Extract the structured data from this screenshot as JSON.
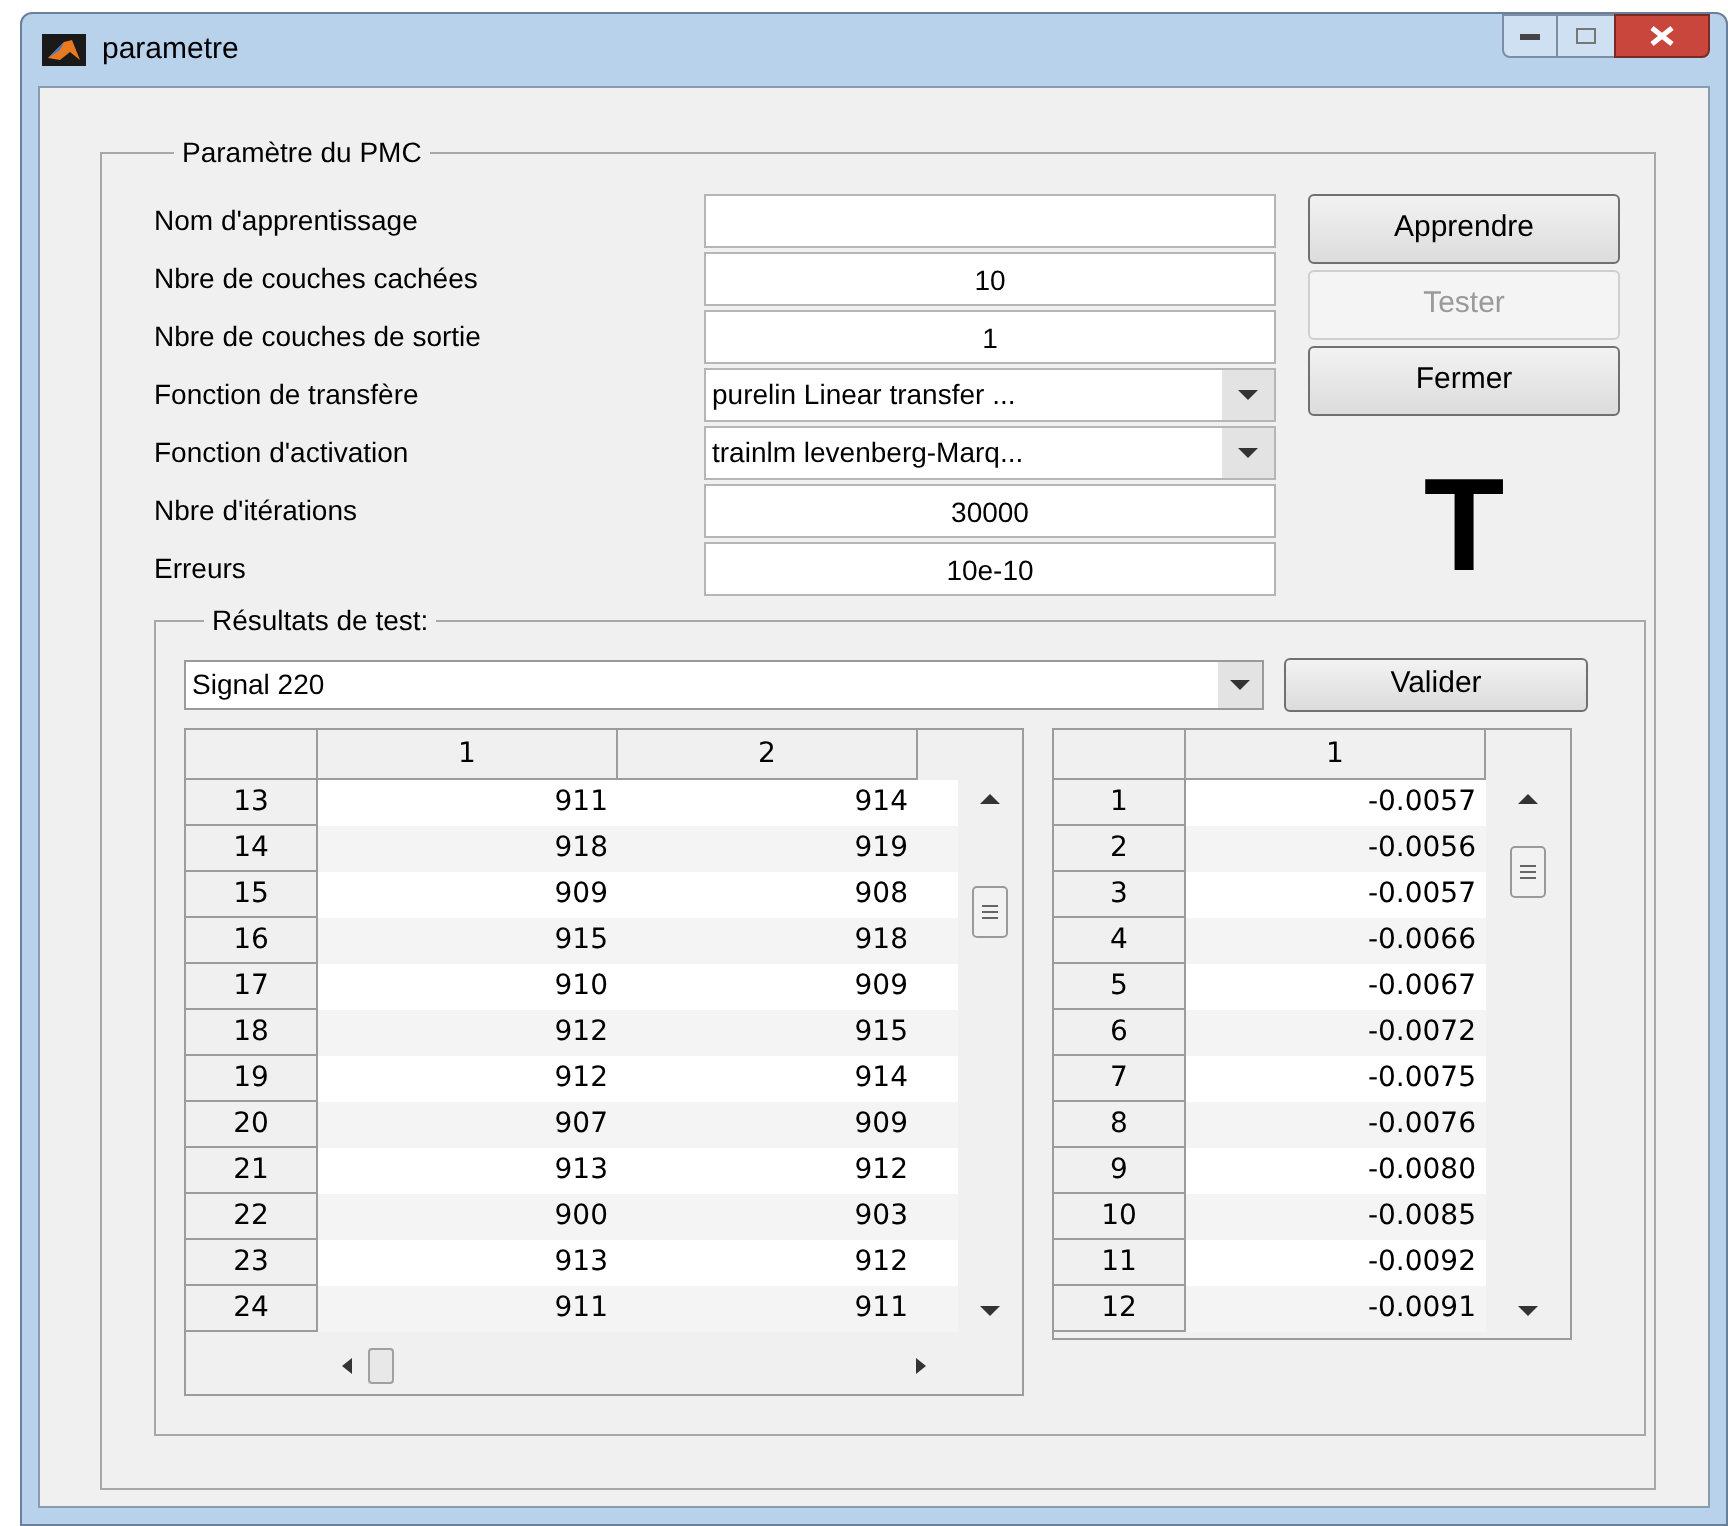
{
  "window": {
    "title": "parametre"
  },
  "parameters": {
    "title": "Paramètre du PMC",
    "fields": [
      {
        "label": "Nom d'apprentissage",
        "kind": "text"
      },
      {
        "label": "Nbre de couches cachées",
        "kind": "text",
        "value": "10"
      },
      {
        "label": "Nbre de couches de sortie",
        "kind": "text",
        "value": "1"
      },
      {
        "label": "Fonction de transfère",
        "kind": "dropdown",
        "value": "purelin Linear transfer ..."
      },
      {
        "label": "Fonction d'activation",
        "kind": "dropdown",
        "value": "trainlm levenberg-Marq..."
      },
      {
        "label": "Nbre d'itérations",
        "kind": "text",
        "value": "30000"
      },
      {
        "label": "Erreurs",
        "kind": "text",
        "value": "10e-10"
      }
    ],
    "buttons": [
      {
        "label": "Apprendre",
        "disabled": false
      },
      {
        "label": "Tester",
        "disabled": true
      },
      {
        "label": "Fermer",
        "disabled": false
      }
    ],
    "big_letter": "T"
  },
  "results": {
    "title": "Résultats de test:",
    "signal": "Signal 220",
    "validate": "Valider",
    "input_table": {
      "columns": [
        "1",
        "2"
      ],
      "rows": [
        {
          "header": "13",
          "cells": [
            "911",
            "914"
          ]
        },
        {
          "header": "14",
          "cells": [
            "918",
            "919"
          ]
        },
        {
          "header": "15",
          "cells": [
            "909",
            "908"
          ]
        },
        {
          "header": "16",
          "cells": [
            "915",
            "918"
          ]
        },
        {
          "header": "17",
          "cells": [
            "910",
            "909"
          ]
        },
        {
          "header": "18",
          "cells": [
            "912",
            "915"
          ]
        },
        {
          "header": "19",
          "cells": [
            "912",
            "914"
          ]
        },
        {
          "header": "20",
          "cells": [
            "907",
            "909"
          ]
        },
        {
          "header": "21",
          "cells": [
            "913",
            "912"
          ]
        },
        {
          "header": "22",
          "cells": [
            "900",
            "903"
          ]
        },
        {
          "header": "23",
          "cells": [
            "913",
            "912"
          ]
        },
        {
          "header": "24",
          "cells": [
            "911",
            "911"
          ]
        }
      ]
    },
    "output_table": {
      "columns": [
        "1"
      ],
      "rows": [
        {
          "header": "1",
          "cells": [
            "-0.0057"
          ]
        },
        {
          "header": "2",
          "cells": [
            "-0.0056"
          ]
        },
        {
          "header": "3",
          "cells": [
            "-0.0057"
          ]
        },
        {
          "header": "4",
          "cells": [
            "-0.0066"
          ]
        },
        {
          "header": "5",
          "cells": [
            "-0.0067"
          ]
        },
        {
          "header": "6",
          "cells": [
            "-0.0072"
          ]
        },
        {
          "header": "7",
          "cells": [
            "-0.0075"
          ]
        },
        {
          "header": "8",
          "cells": [
            "-0.0076"
          ]
        },
        {
          "header": "9",
          "cells": [
            "-0.0080"
          ]
        },
        {
          "header": "10",
          "cells": [
            "-0.0085"
          ]
        },
        {
          "header": "11",
          "cells": [
            "-0.0092"
          ]
        },
        {
          "header": "12",
          "cells": [
            "-0.0091"
          ]
        }
      ]
    }
  }
}
